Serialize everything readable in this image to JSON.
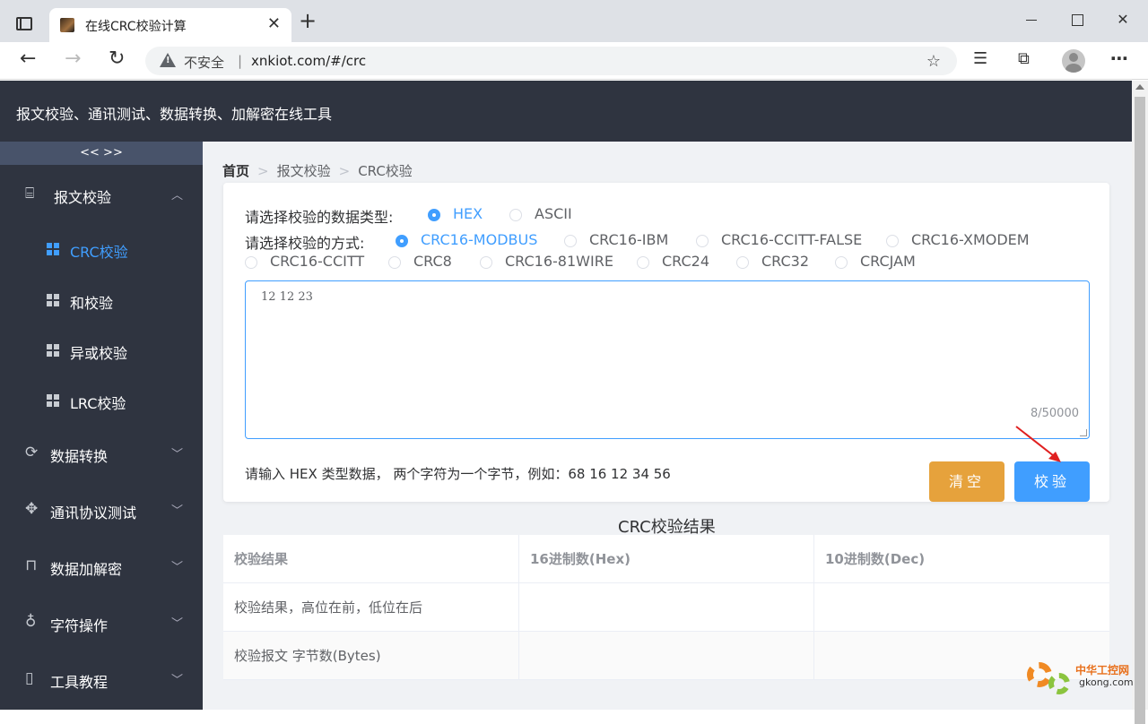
{
  "browser": {
    "tab_title": "在线CRC校验计算",
    "insecure_label": "不安全",
    "separator": "|",
    "url": "xnkiot.com/#/crc"
  },
  "header": {
    "title": "报文校验、通讯测试、数据转换、加解密在线工具"
  },
  "sidebar": {
    "collapse_label": "<< >>",
    "groups": [
      {
        "label": "报文校验",
        "icon": "presentation-icon",
        "expanded": true,
        "items": [
          {
            "label": "CRC校验",
            "active": true
          },
          {
            "label": "和校验"
          },
          {
            "label": "异或校验"
          },
          {
            "label": "LRC校验"
          }
        ]
      },
      {
        "label": "数据转换",
        "icon": "refresh-icon"
      },
      {
        "label": "通讯协议测试",
        "icon": "move-icon"
      },
      {
        "label": "数据加解密",
        "icon": "lock-icon"
      },
      {
        "label": "字符操作",
        "icon": "user-icon"
      },
      {
        "label": "工具教程",
        "icon": "book-icon"
      }
    ]
  },
  "breadcrumb": {
    "home": "首页",
    "level1": "报文校验",
    "level2": "CRC校验",
    "sep": ">"
  },
  "form": {
    "datatype_label": "请选择校验的数据类型:",
    "datatype_options": [
      "HEX",
      "ASCII"
    ],
    "datatype_selected": "HEX",
    "method_label": "请选择校验的方式:",
    "method_options": [
      "CRC16-MODBUS",
      "CRC16-IBM",
      "CRC16-CCITT-FALSE",
      "CRC16-XMODEM",
      "CRC16-CCITT",
      "CRC8",
      "CRC16-81WIRE",
      "CRC24",
      "CRC32",
      "CRCJAM"
    ],
    "method_selected": "CRC16-MODBUS",
    "input_value": "12 12 23",
    "char_count": "8/50000",
    "hint": "请输入 HEX 类型数据， 两个字符为一个字节，例如：68 16 12 34 56",
    "clear_button": "清空",
    "verify_button": "校验"
  },
  "result": {
    "title": "CRC校验结果",
    "columns": [
      "校验结果",
      "16进制数(Hex)",
      "10进制数(Dec)"
    ],
    "rows": [
      [
        "校验结果，高位在前，低位在后",
        "",
        ""
      ],
      [
        "校验报文 字节数(Bytes)",
        "",
        ""
      ]
    ]
  },
  "watermark": {
    "text": "中华工控网",
    "sub": "gkong.com"
  },
  "colors": {
    "primary": "#409eff",
    "warning": "#e6a23c",
    "sidebar_bg": "#2f3440"
  }
}
